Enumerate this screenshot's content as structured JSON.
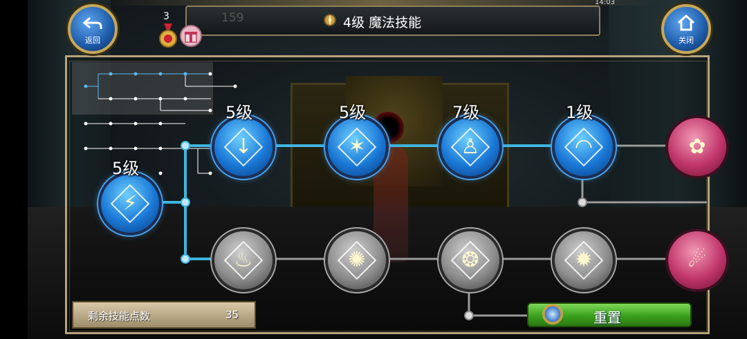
{
  "header": {
    "title": "4级 魔法技能",
    "back_label": "返回",
    "close_label": "关闭",
    "badge_count": "3",
    "gold_count": "159",
    "status_time": "14:03"
  },
  "skill_tree": {
    "nodes": [
      {
        "id": "n1",
        "style": "blue",
        "level_label": "5级",
        "glyph": "⚡"
      },
      {
        "id": "n2",
        "style": "blue",
        "level_label": "5级",
        "glyph": "↓"
      },
      {
        "id": "n3",
        "style": "blue",
        "level_label": "5级",
        "glyph": "✶"
      },
      {
        "id": "n4",
        "style": "blue",
        "level_label": "7级",
        "glyph": "♙"
      },
      {
        "id": "n5",
        "style": "blue",
        "level_label": "1级",
        "glyph": "◠"
      },
      {
        "id": "n6",
        "style": "pink",
        "level_label": "",
        "glyph": "✿"
      },
      {
        "id": "n7",
        "style": "gray",
        "level_label": "",
        "glyph": "♨"
      },
      {
        "id": "n8",
        "style": "gray",
        "level_label": "",
        "glyph": "✺"
      },
      {
        "id": "n9",
        "style": "gray",
        "level_label": "",
        "glyph": "❂"
      },
      {
        "id": "n10",
        "style": "gray",
        "level_label": "",
        "glyph": "✹"
      },
      {
        "id": "n11",
        "style": "pink",
        "level_label": "",
        "glyph": "☄"
      }
    ]
  },
  "footer": {
    "points_label": "剩余技能点数",
    "points_value": "35",
    "reset_label": "重置"
  },
  "colors": {
    "active_line": "#3fb5e0",
    "inactive_line": "#9a9a9a",
    "panel_border": "#b8a47a",
    "reset_green": "#3aa01c"
  }
}
